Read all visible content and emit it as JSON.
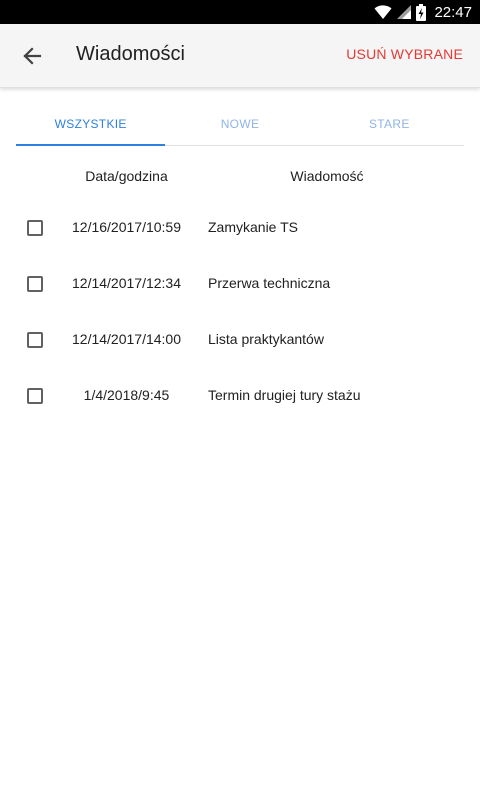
{
  "status_bar": {
    "time": "22:47",
    "icons": [
      "wifi-icon",
      "signal-icon",
      "battery-charging-icon"
    ]
  },
  "app_bar": {
    "title": "Wiadomości",
    "back_icon": "arrow-back-icon",
    "action_label": "USUŃ WYBRANE",
    "action_color": "#e53935"
  },
  "tabs": [
    {
      "label": "WSZYSTKIE",
      "active": true
    },
    {
      "label": "NOWE",
      "active": false
    },
    {
      "label": "STARE",
      "active": false
    }
  ],
  "accent_color": "#2f7fe0",
  "table": {
    "headers": {
      "date": "Data/godzina",
      "message": "Wiadomość"
    },
    "rows": [
      {
        "checked": false,
        "date": "12/16/2017/10:59",
        "message": "Zamykanie TS"
      },
      {
        "checked": false,
        "date": "12/14/2017/12:34",
        "message": "Przerwa techniczna"
      },
      {
        "checked": false,
        "date": "12/14/2017/14:00",
        "message": "Lista praktykantów"
      },
      {
        "checked": false,
        "date": "1/4/2018/9:45",
        "message": "Termin drugiej tury stażu"
      }
    ]
  }
}
